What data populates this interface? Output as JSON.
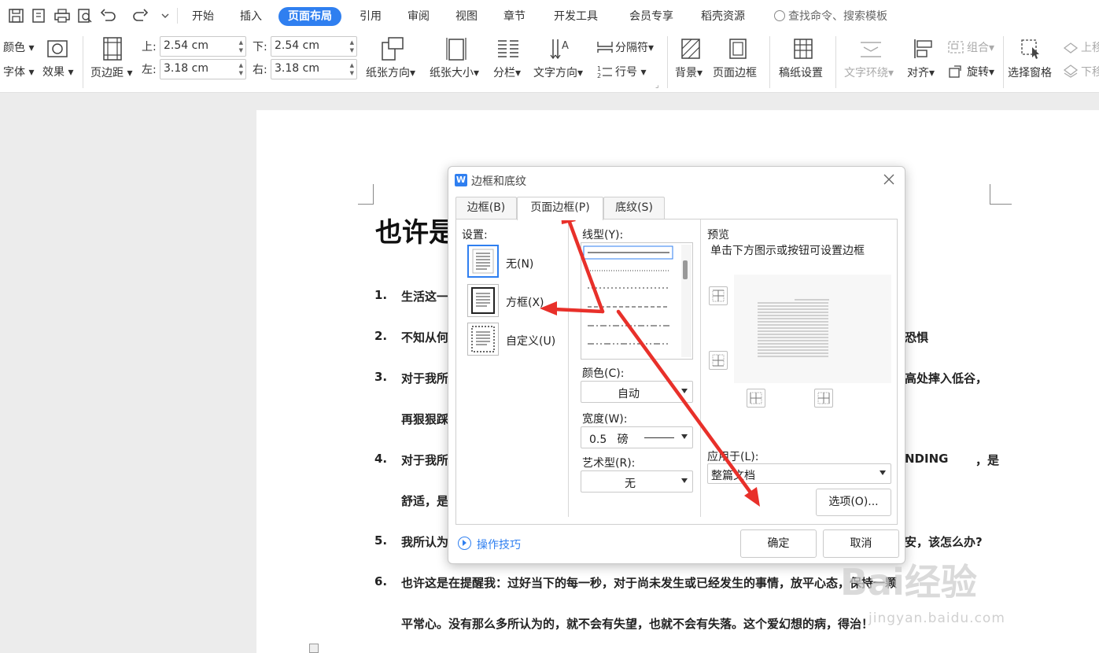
{
  "menubar": {
    "tabs": [
      "开始",
      "插入",
      "页面布局",
      "引用",
      "审阅",
      "视图",
      "章节",
      "开发工具",
      "会员专享",
      "稻壳资源"
    ],
    "active_tab": "页面布局",
    "search_placeholder": "查找命令、搜索模板"
  },
  "ribbon": {
    "color_label": "颜色",
    "font_label": "字体",
    "effect_label": "效果",
    "margins_label": "页边距",
    "margin_top_label": "上:",
    "margin_top_value": "2.54 cm",
    "margin_bottom_label": "下:",
    "margin_bottom_value": "2.54 cm",
    "margin_left_label": "左:",
    "margin_left_value": "3.18 cm",
    "margin_right_label": "右:",
    "margin_right_value": "3.18 cm",
    "orientation_label": "纸张方向",
    "size_label": "纸张大小",
    "columns_label": "分栏",
    "text_direction_label": "文字方向",
    "separator_label": "分隔符",
    "line_number_label": "行号",
    "background_label": "背景",
    "page_border_label": "页面边框",
    "draft_paper_label": "稿纸设置",
    "text_wrap_label": "文字环绕",
    "align_label": "对齐",
    "group_label": "组合",
    "rotate_label": "旋转",
    "selection_pane_label": "选择窗格",
    "bring_up_label": "上移",
    "send_down_label": "下移"
  },
  "document": {
    "title": "也许是",
    "lines": [
      {
        "num": "1.",
        "text": "生活这一"
      },
      {
        "num": "2.",
        "text": "不知从何"
      },
      {
        "num": "3.",
        "text": "对于我所"
      },
      {
        "num": "",
        "text": "再狠狠踩"
      },
      {
        "num": "4.",
        "text": "对于我所"
      },
      {
        "num": "",
        "text": "舒适，是"
      },
      {
        "num": "5.",
        "text": "我所认为"
      },
      {
        "num": "6.",
        "text": "也许这是在提醒我：过好当下的每一秒，对于尚未发生或已经发生的事情，放平心态，保持一颗"
      },
      {
        "num": "",
        "text": "平常心。没有那么多所认为的，就不会有失望，也就不会有失落。这个爱幻想的病，得治！"
      }
    ],
    "right_fragments": [
      "恐惧",
      "高处摔入低谷，",
      "NDING",
      "，是",
      "安，该怎么办?"
    ]
  },
  "dialog": {
    "title": "边框和底纹",
    "tabs": [
      "边框(B)",
      "页面边框(P)",
      "底纹(S)"
    ],
    "active_tab": "页面边框(P)",
    "setting_label": "设置:",
    "settings": [
      "无(N)",
      "方框(X)",
      "自定义(U)"
    ],
    "line_style_label": "线型(Y):",
    "color_label": "颜色(C):",
    "color_value": "自动",
    "width_label": "宽度(W):",
    "width_value": "0.5   磅",
    "art_label": "艺术型(R):",
    "art_value": "无",
    "preview_label": "预览",
    "preview_hint": "单击下方图示或按钮可设置边框",
    "apply_label": "应用于(L):",
    "apply_value": "整篇文档",
    "options_button": "选项(O)...",
    "tips_link": "操作技巧",
    "ok_button": "确定",
    "cancel_button": "取消"
  },
  "watermark": {
    "brand": "Bai经验",
    "url": "jingyan.baidu.com"
  },
  "colors": {
    "accent": "#2f7ff0",
    "arrow": "#e8302a"
  }
}
